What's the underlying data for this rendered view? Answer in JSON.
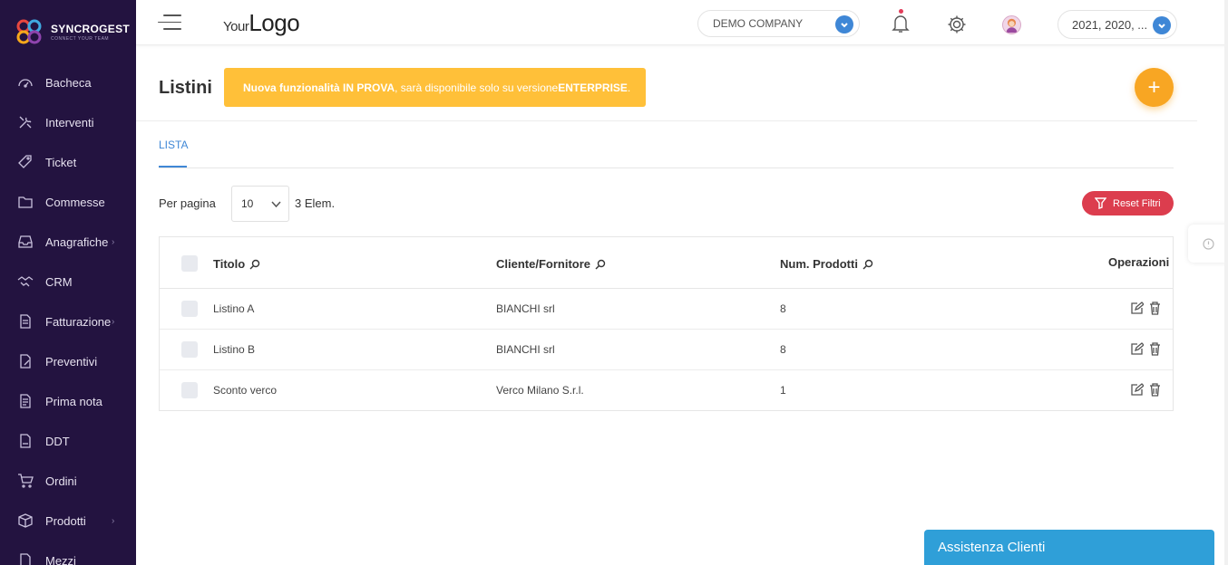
{
  "brand": {
    "name": "SYNCROGEST",
    "tagline": "CONNECT YOUR TEAM"
  },
  "sidebar": {
    "items": [
      {
        "label": "Bacheca",
        "icon": "dashboard-icon",
        "has_submenu": false
      },
      {
        "label": "Interventi",
        "icon": "tools-icon",
        "has_submenu": false
      },
      {
        "label": "Ticket",
        "icon": "ticket-icon",
        "has_submenu": false
      },
      {
        "label": "Commesse",
        "icon": "folder-icon",
        "has_submenu": false
      },
      {
        "label": "Anagrafiche",
        "icon": "inbox-icon",
        "has_submenu": true
      },
      {
        "label": "CRM",
        "icon": "handshake-icon",
        "has_submenu": false
      },
      {
        "label": "Fatturazione",
        "icon": "invoice-icon",
        "has_submenu": true
      },
      {
        "label": "Preventivi",
        "icon": "quote-icon",
        "has_submenu": false
      },
      {
        "label": "Prima nota",
        "icon": "note-icon",
        "has_submenu": false
      },
      {
        "label": "DDT",
        "icon": "document-icon",
        "has_submenu": false
      },
      {
        "label": "Ordini",
        "icon": "cart-icon",
        "has_submenu": false
      },
      {
        "label": "Prodotti",
        "icon": "box-icon",
        "has_submenu": true
      },
      {
        "label": "Mezzi",
        "icon": "vehicle-icon",
        "has_submenu": false
      }
    ]
  },
  "topbar": {
    "logo_small": "Your",
    "logo_large": "Logo",
    "company": "DEMO COMPANY",
    "years": "2021, 2020, ..."
  },
  "page": {
    "title": "Listini",
    "banner_bold_1": "Nuova funzionalità IN PROVA",
    "banner_text": ", sarà disponibile solo su versione ",
    "banner_bold_2": "ENTERPRISE",
    "banner_end": ".",
    "add_label": "+"
  },
  "tabs": [
    {
      "label": "LISTA",
      "active": true
    }
  ],
  "pagination": {
    "per_page_label": "Per pagina",
    "per_page_value": "10",
    "count_text": "3 Elem."
  },
  "reset_label": "Reset Filtri",
  "table": {
    "columns": [
      "Titolo",
      "Cliente/Fornitore",
      "Num. Prodotti",
      "Operazioni"
    ],
    "rows": [
      {
        "titolo": "Listino A",
        "cliente": "BIANCHI srl",
        "num": "8"
      },
      {
        "titolo": "Listino B",
        "cliente": "BIANCHI srl",
        "num": "8"
      },
      {
        "titolo": "Sconto verco",
        "cliente": "Verco Milano S.r.l.",
        "num": "1"
      }
    ]
  },
  "assist_label": "Assistenza Clienti",
  "colors": {
    "sidebar_bg": "#231340",
    "accent_blue": "#3f87d6",
    "banner_yellow": "#ffc039",
    "fab_orange": "#f8a623",
    "reset_red": "#dc3d4e",
    "assist_blue": "#2f9fd8"
  }
}
